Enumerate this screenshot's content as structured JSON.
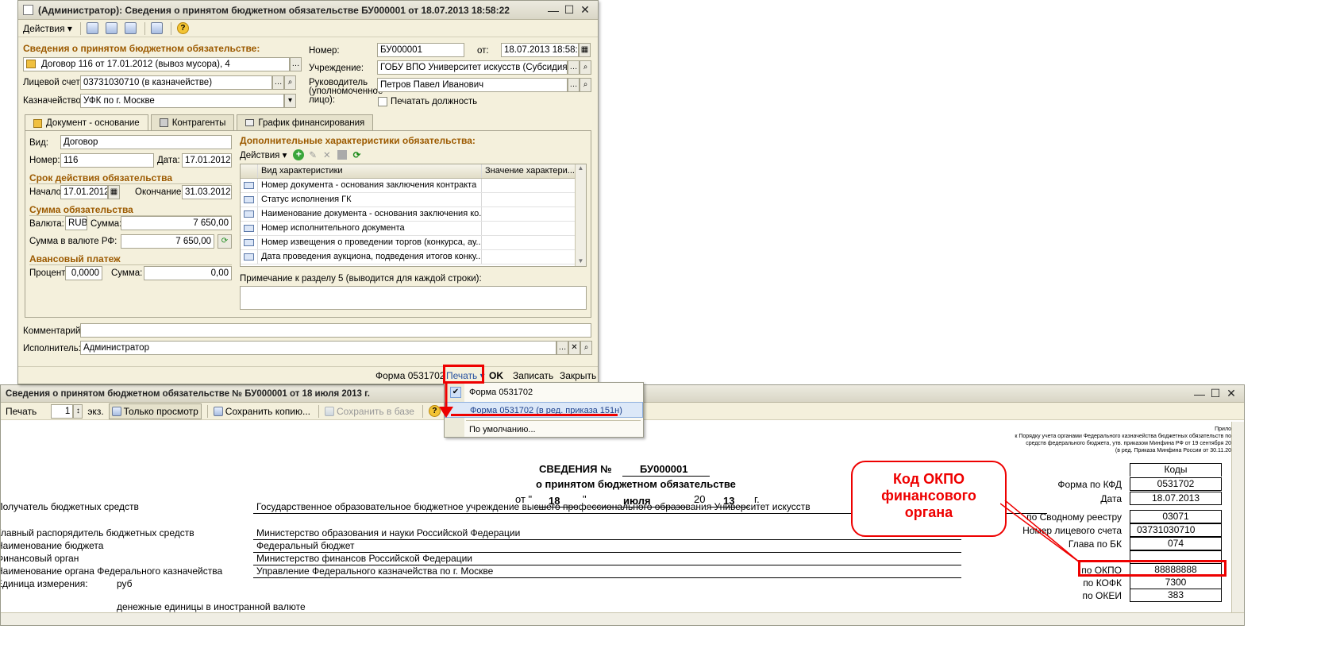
{
  "colors": {
    "accent_section": "#9c5a00",
    "annotation_red": "#e00000",
    "window_bg": "#f4f0dc"
  },
  "form_window": {
    "title": "(Администратор): Сведения о принятом бюджетном обязательстве БУ000001 от 18.07.2013 18:58:22",
    "toolbar": {
      "actions_label": "Действия"
    },
    "section_title": "Сведения о принятом бюджетном обязательстве:",
    "contract_value": "Договор 116 от 17.01.2012 (вывоз мусора), 4",
    "account_label": "Лицевой счет:",
    "account_value": "03731030710 (в казначействе)",
    "treasury_label": "Казначейство:",
    "treasury_value": "УФК по г. Москве",
    "number_label": "Номер:",
    "number_value": "БУ000001",
    "from_label": "от:",
    "from_value": "18.07.2013 18:58:22",
    "institution_label": "Учреждение:",
    "institution_value": "ГОБУ ВПО Университет искусств (Субсидия)",
    "head_label_1": "Руководитель",
    "head_label_2": "(уполномоченное",
    "head_label_3": "лицо):",
    "head_value": "Петров Павел Иванович",
    "print_position_label": "Печатать должность",
    "tabs": [
      "Документ - основание",
      "Контрагенты",
      "График финансирования"
    ],
    "doc": {
      "kind_label": "Вид:",
      "kind_value": "Договор",
      "num_label": "Номер:",
      "num_value": "116",
      "date_label": "Дата:",
      "date_value": "17.01.2012",
      "term_title": "Срок действия обязательства",
      "start_label": "Начало:",
      "start_value": "17.01.2012",
      "end_label": "Окончание:",
      "end_value": "31.03.2012",
      "sum_title": "Сумма обязательства",
      "currency_label": "Валюта:",
      "currency_value": "RUB",
      "sum_label": "Сумма:",
      "sum_value": "7 650,00",
      "sum_rub_label": "Сумма в валюте РФ:",
      "sum_rub_value": "7 650,00",
      "advance_title": "Авансовый платеж",
      "percent_label": "Процент:",
      "percent_value": "0,0000",
      "adv_sum_label": "Сумма:",
      "adv_sum_value": "0,00"
    },
    "extra": {
      "title": "Дополнительные характеристики обязательства:",
      "actions_label": "Действия",
      "col1": "Вид характеристики",
      "col2": "Значение характери...",
      "rows": [
        "Номер документа - основания заключения контракта",
        "Статус исполнения ГК",
        "Наименование документа - основания заключения ко...",
        "Номер исполнительного документа",
        "Номер извещения о проведении торгов (конкурса, ау...",
        "Дата проведения аукциона, подведения итогов конку..."
      ],
      "note_label": "Примечание к разделу 5 (выводится для каждой строки):"
    },
    "comment_label": "Комментарий:",
    "executor_label": "Исполнитель:",
    "executor_value": "Администратор",
    "footer": {
      "form_label": "Форма 0531702",
      "print_label": "Печать",
      "ok_label": "OK",
      "save_label": "Записать",
      "close_label": "Закрыть"
    }
  },
  "print_menu": {
    "items": [
      "Форма 0531702",
      "Форма 0531702 (в ред. приказа 151н)",
      "По умолчанию..."
    ]
  },
  "print_window": {
    "title": "Сведения о принятом бюджетном обязательстве № БУ000001 от 18 июля 2013 г.",
    "toolbar": {
      "print_label": "Печать",
      "copies": "1",
      "copies_suffix": "экз.",
      "view_only_label": "Только просмотр",
      "save_copy_label": "Сохранить копию...",
      "save_db_label": "Сохранить в базе"
    },
    "header_notes": [
      "Прило",
      "к Порядку учета органами Федерального казначейства бюджетных обязательств по",
      "средств федерального бюджета, утв. приказом Минфина РФ от 19 сентября 20",
      "(в ред. Приказа Минфина России от 30.11.20"
    ],
    "heading_1": "СВЕДЕНИЯ №",
    "heading_num": "БУ000001",
    "heading_2": "о принятом бюджетном обязательстве",
    "date_from": "от \"",
    "date_day": "18",
    "date_quote": "\"",
    "date_month": "июля",
    "date_century": "20",
    "date_year": "13",
    "date_suffix": "г.",
    "codes_header": "Коды",
    "rows": [
      {
        "label": "Получатель бюджетных средств",
        "value": "Государственное образовательное бюджетное учреждение высшего профессионального образования  Университет искусств"
      },
      {
        "label": "Главный распорядитель бюджетных средств",
        "value": "Министерство образования и науки Российской Федерации"
      },
      {
        "label": "Наименование бюджета",
        "value": "Федеральный бюджет"
      },
      {
        "label": "Финансовый орган",
        "value": "Министерство финансов Российской Федерации"
      },
      {
        "label": "Наименование органа Федерального казначейства",
        "value": "Управление Федерального казначейства по г. Москве"
      },
      {
        "label": "Единица измерения:",
        "value": "руб"
      }
    ],
    "unit_note": "денежные единицы в иностранной валюте",
    "code_rows": [
      {
        "label": "Форма по КФД",
        "value": "0531702"
      },
      {
        "label": "Дата",
        "value": "18.07.2013"
      },
      {
        "label": "по Сводному реестру",
        "value": "03071"
      },
      {
        "label": "Номер лицевого счета",
        "value": "03731030710"
      },
      {
        "label": "Глава по БК",
        "value": "074"
      },
      {
        "label": "",
        "value": ""
      },
      {
        "label": "по ОКПО",
        "value": "88888888"
      },
      {
        "label": "по КОФК",
        "value": "7300"
      },
      {
        "label": "по ОКЕИ",
        "value": "383"
      }
    ]
  },
  "callout_text": [
    "Код ОКПО",
    "финансового",
    "органа"
  ]
}
